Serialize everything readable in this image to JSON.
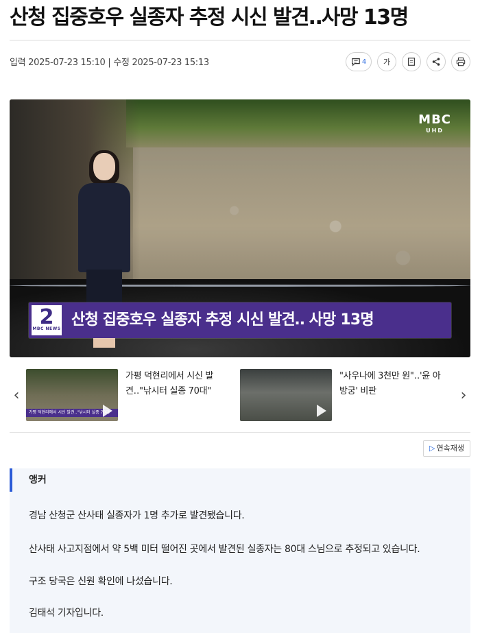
{
  "article": {
    "headline": "산청 집중호우 실종자 추정 시신 발견‥사망 13명",
    "meta": {
      "input_label": "입력",
      "input_time": "2025-07-23 15:10",
      "separator": "|",
      "modified_label": "수정",
      "modified_time": "2025-07-23 15:13"
    },
    "tools": {
      "comment_count": "4",
      "font_size_label": "가",
      "icons": [
        "comment-icon",
        "font-size-icon",
        "bookmark-icon",
        "share-icon",
        "print-icon"
      ]
    }
  },
  "video": {
    "broadcaster_logo": "MBC",
    "logo_sub": "UHD",
    "channel_number": "2",
    "channel_sub": "MBC NEWS",
    "lower_third_text": "산청 집중호우 실종자 추정 시신 발견‥ 사망 13명"
  },
  "related": [
    {
      "title": "가평 덕현리에서 시신 발견‥\"낚시터 실종 70대\"",
      "thumb_caption": "가평 덕현리에서 시신 발견‥\"낚시터 실종 70대\""
    },
    {
      "title": "\"사우나에 3천만 원\"‥'윤 아방궁' 비판",
      "thumb_caption": ""
    }
  ],
  "autoplay_label": "연속재생",
  "body": {
    "role": "앵커",
    "paragraphs": [
      "경남 산청군 산사태 실종자가 1명 추가로 발견됐습니다.",
      "산사태 사고지점에서 약 5백 미터 떨어진 곳에서 발견된 실종자는 80대 스님으로 추정되고 있습니다.",
      "구조 당국은 신원 확인에 나섰습니다.",
      "김태석 기자입니다."
    ]
  },
  "colors": {
    "accent": "#2b5bd7",
    "lower_third": "#4a2f8c",
    "link_blue": "#2b6be0"
  }
}
